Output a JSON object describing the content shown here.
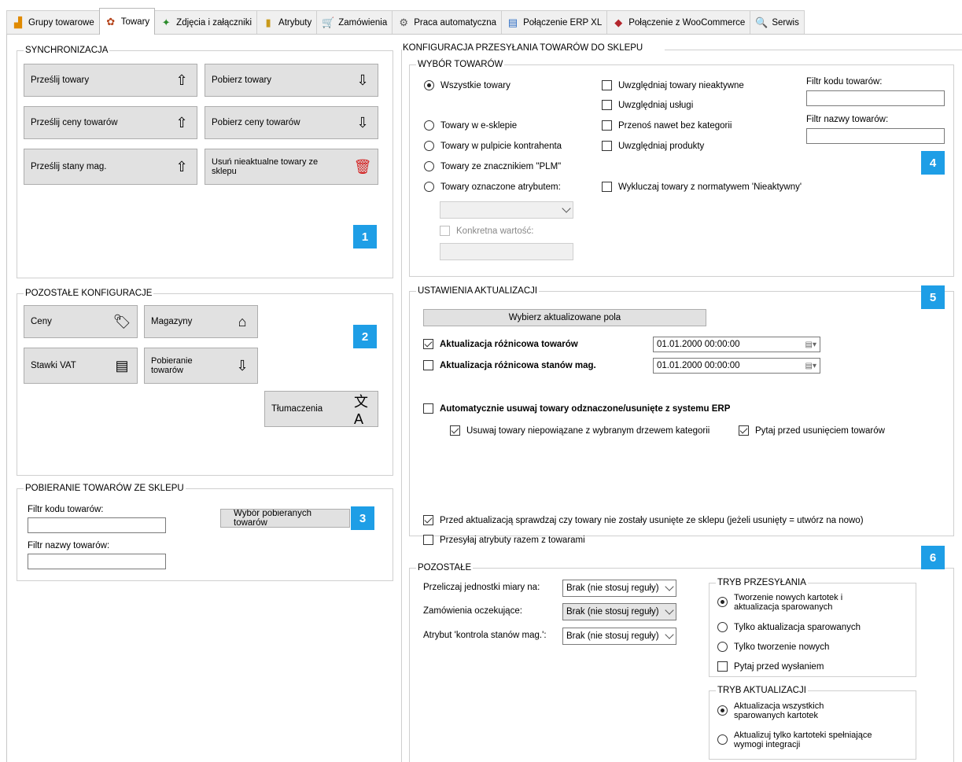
{
  "tabs": [
    {
      "label": "Grupy towarowe",
      "icon": "product-groups-icon"
    },
    {
      "label": "Towary",
      "icon": "products-icon"
    },
    {
      "label": "Zdjęcia i załączniki",
      "icon": "images-icon"
    },
    {
      "label": "Atrybuty",
      "icon": "attributes-icon"
    },
    {
      "label": "Zamówienia",
      "icon": "cart-icon"
    },
    {
      "label": "Praca automatyczna",
      "icon": "gears-icon"
    },
    {
      "label": "Połączenie ERP XL",
      "icon": "erp-icon"
    },
    {
      "label": "Połączenie z WooCommerce",
      "icon": "woocommerce-icon"
    },
    {
      "label": "Serwis",
      "icon": "search-icon"
    }
  ],
  "sync": {
    "title": "SYNCHRONIZACJA",
    "send_products": "Prześlij towary",
    "get_products": "Pobierz towary",
    "send_prices": "Prześlij ceny towarów",
    "get_prices": "Pobierz ceny towarów",
    "send_stock": "Prześlij stany mag.",
    "remove_outdated": "Usuń nieaktualne towary ze sklepu",
    "badge": "1"
  },
  "other": {
    "title": "POZOSTAŁE KONFIGURACJE",
    "prices": "Ceny",
    "warehouses": "Magazyny",
    "vat": "Stawki VAT",
    "download": "Pobieranie towarów",
    "translations": "Tłumaczenia",
    "badge": "2"
  },
  "shop_download": {
    "title": "POBIERANIE TOWARÓW ZE SKLEPU",
    "code_filter_label": "Filtr kodu towarów:",
    "code_filter_value": "",
    "name_filter_label": "Filtr nazwy towarów:",
    "name_filter_value": "",
    "select_button": "Wybór pobieranych towarów",
    "badge": "3"
  },
  "config": {
    "title": "KONFIGURACJA PRZESYŁANIA TOWARÓW DO SKLEPU"
  },
  "selection": {
    "title": "WYBÓR TOWARÓW",
    "radios": [
      "Wszystkie towary",
      "Towary w e-sklepie",
      "Towary w pulpicie kontrahenta",
      "Towary ze znacznikiem \"PLM\"",
      "Towary oznaczone atrybutem:"
    ],
    "attribute_select": "",
    "specific_value": "Konkretna wartość:",
    "specific_value_input": "",
    "checks": [
      "Uwzględniaj towary nieaktywne",
      "Uwzględniaj usługi",
      "Przenoś nawet bez kategorii",
      "Uwzględniaj produkty",
      "Wykluczaj towary z normatywem 'Nieaktywny'"
    ],
    "code_filter_label": "Filtr kodu towarów:",
    "code_filter_value": "",
    "name_filter_label": "Filtr nazwy towarów:",
    "name_filter_value": "",
    "badge": "4"
  },
  "update": {
    "title": "USTAWIENIA AKTUALIZACJI",
    "choose_fields": "Wybierz aktualizowane pola",
    "diff_products": "Aktualizacja różnicowa towarów",
    "diff_products_date": "01.01.2000 00:00:00",
    "diff_stock": "Aktualizacja różnicowa stanów mag.",
    "diff_stock_date": "01.01.2000 00:00:00",
    "auto_remove": "Automatycznie usuwaj towary odznaczone/usunięte z systemu ERP",
    "remove_unrelated": "Usuwaj towary niepowiązane z wybranym drzewem kategorii",
    "ask_before_remove": "Pytaj przed usunięciem towarów",
    "check_removed": "Przed aktualizacją sprawdzaj czy towary nie zostały usunięte ze sklepu (jeżeli usunięty = utwórz na nowo)",
    "send_attributes": "Przesyłaj atrybuty razem z towarami",
    "badge": "5"
  },
  "remaining": {
    "title": "POZOSTAŁE",
    "unit_label": "Przeliczaj jednostki miary na:",
    "unit_value": "Brak (nie stosuj reguły)",
    "orders_label": "Zamówienia oczekujące:",
    "orders_value": "Brak (nie stosuj reguły)",
    "stock_attr_label": "Atrybut 'kontrola stanów mag.':",
    "stock_attr_value": "Brak (nie stosuj reguły)",
    "send_mode_title": "TRYB PRZESYŁANIA",
    "send_mode_1": "Tworzenie nowych kartotek i aktualizacja sparowanych",
    "send_mode_2": "Tylko aktualizacja sparowanych",
    "send_mode_3": "Tylko tworzenie nowych",
    "ask_before_send": "Pytaj przed wysłaniem",
    "update_mode_title": "TRYB AKTUALIZACJI",
    "update_mode_1": "Aktualizacja wszystkich sparowanych kartotek",
    "update_mode_2": "Aktualizuj tylko kartoteki spełniające wymogi integracji",
    "badge": "6"
  },
  "colors": {
    "badge": "#1e9ee6",
    "button": "#e1e1e1",
    "delete_icon": "#d32020"
  }
}
